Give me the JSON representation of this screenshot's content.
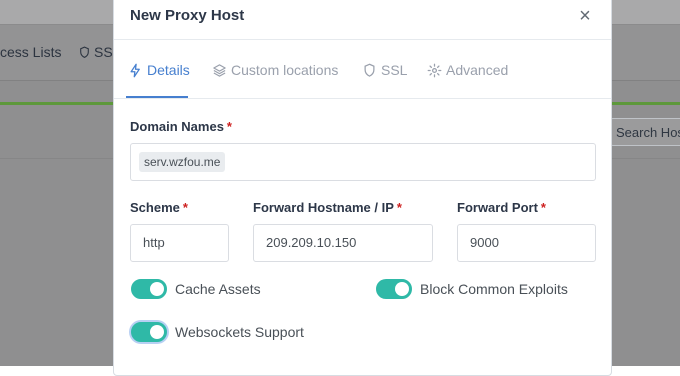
{
  "background": {
    "nav_items": [
      "cess Lists",
      "SSL"
    ],
    "search_placeholder": "Search Hos"
  },
  "modal": {
    "title": "New Proxy Host",
    "close_symbol": "×",
    "tabs": [
      {
        "label": "Details",
        "icon": "lightning-icon",
        "active": true
      },
      {
        "label": "Custom locations",
        "icon": "layers-icon",
        "active": false
      },
      {
        "label": "SSL",
        "icon": "shield-icon",
        "active": false
      },
      {
        "label": "Advanced",
        "icon": "gear-icon",
        "active": false
      }
    ],
    "fields": {
      "domain_names": {
        "label": "Domain Names",
        "required_mark": "*",
        "tags": [
          "serv.wzfou.me"
        ]
      },
      "scheme": {
        "label": "Scheme",
        "required_mark": "*",
        "value": "http"
      },
      "forward_host": {
        "label": "Forward Hostname / IP",
        "required_mark": "*",
        "value": "209.209.10.150"
      },
      "forward_port": {
        "label": "Forward Port",
        "required_mark": "*",
        "value": "9000"
      }
    },
    "toggles": [
      {
        "label": "Cache Assets",
        "checked": true
      },
      {
        "label": "Block Common Exploits",
        "checked": true
      },
      {
        "label": "Websockets Support",
        "checked": true,
        "focused": true
      }
    ]
  },
  "colors": {
    "accent": "#467fcf",
    "toggle_on": "#2fb9a7",
    "required": "#cd201f",
    "backdrop": "#8f8f90",
    "bg_green_line": "#5d983b"
  }
}
